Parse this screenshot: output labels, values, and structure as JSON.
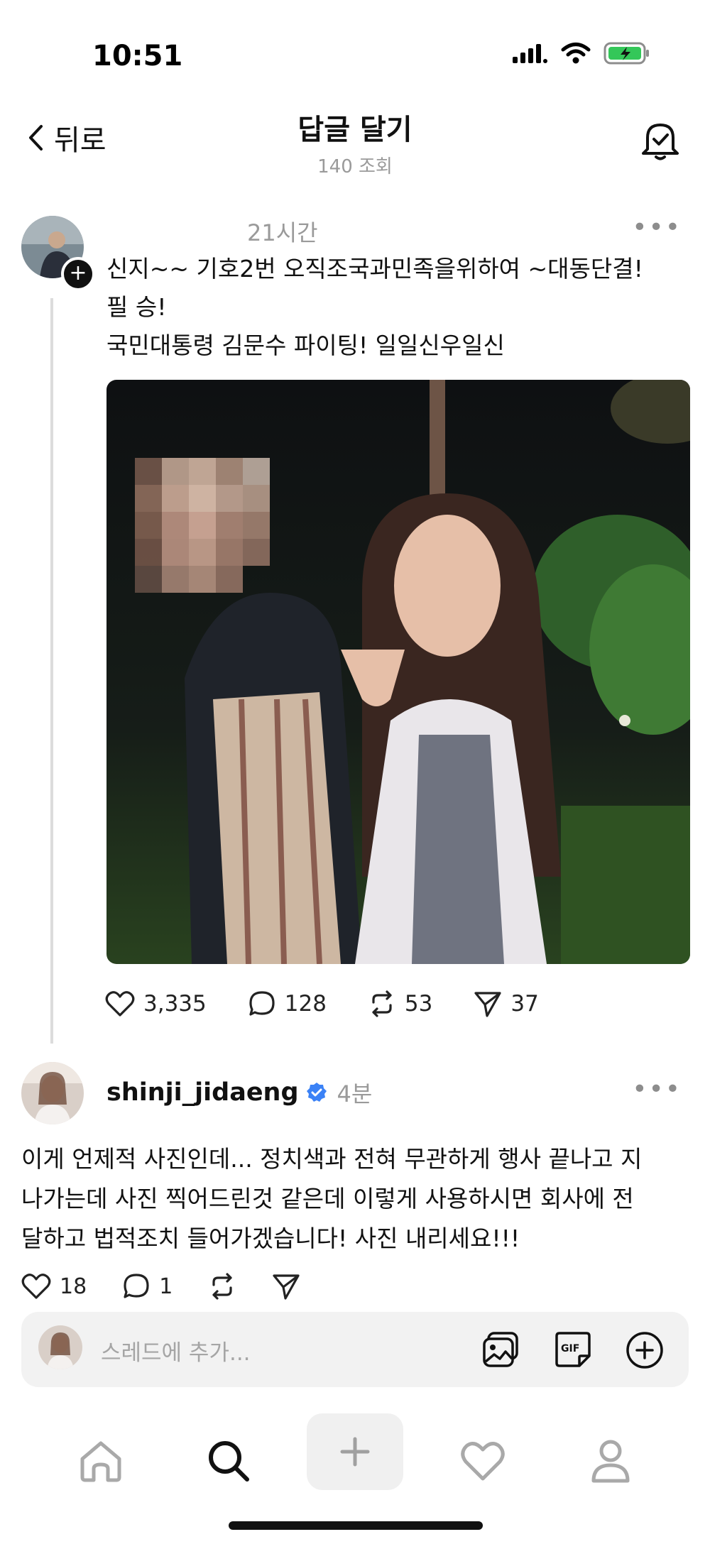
{
  "status_bar": {
    "time": "10:51"
  },
  "nav": {
    "back_label": "뒤로",
    "title": "답글 달기",
    "views": "140 조회"
  },
  "post": {
    "time": "21시간",
    "text_lines": [
      "신지~~ 기호2번  오직조국과민족을위하여 ~대동단결!",
      "필 승!",
      "국민대통령 김문수 파이팅! 일일신우일신"
    ],
    "likes": "3,335",
    "comments": "128",
    "reposts": "53",
    "shares": "37"
  },
  "reply": {
    "username": "shinji_jidaeng",
    "time": "4분",
    "text_lines": [
      "이게 언제적 사진인데... 정치색과 전혀 무관하게 행사 끝나고 지",
      "나가는데 사진 찍어드린것 같은데 이렇게 사용하시면 회사에 전",
      "달하고 법적조치 들어가겠습니다! 사진 내리세요!!!"
    ],
    "likes": "18",
    "comments": "1"
  },
  "composer": {
    "placeholder": "스레드에 추가..."
  },
  "colors": {
    "verified": "#3b82f6",
    "battery": "#34c759"
  },
  "icons": [
    "chevron-left-icon",
    "bell-icon",
    "heart-icon",
    "comment-icon",
    "repost-icon",
    "send-icon",
    "image-icon",
    "gif-icon",
    "plus-circle-icon",
    "home-icon",
    "search-icon",
    "plus-icon",
    "profile-icon"
  ]
}
